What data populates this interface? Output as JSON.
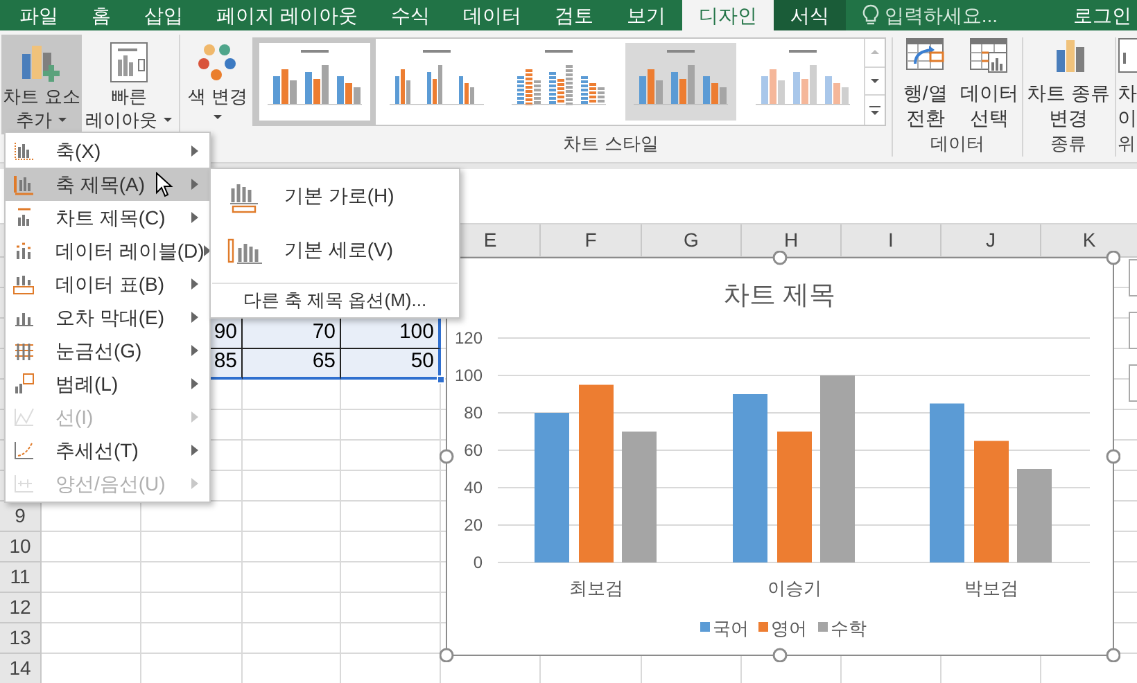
{
  "tabs": [
    {
      "label": "파일",
      "selected": false,
      "contextual": false
    },
    {
      "label": "홈",
      "selected": false,
      "contextual": false
    },
    {
      "label": "삽입",
      "selected": false,
      "contextual": false
    },
    {
      "label": "페이지 레이아웃",
      "selected": false,
      "contextual": false
    },
    {
      "label": "수식",
      "selected": false,
      "contextual": false
    },
    {
      "label": "데이터",
      "selected": false,
      "contextual": false
    },
    {
      "label": "검토",
      "selected": false,
      "contextual": false
    },
    {
      "label": "보기",
      "selected": false,
      "contextual": false
    },
    {
      "label": "디자인",
      "selected": true,
      "contextual": false
    },
    {
      "label": "서식",
      "selected": false,
      "contextual": true
    }
  ],
  "search": {
    "placeholder": "입력하세요..."
  },
  "account": {
    "label": "로그인"
  },
  "ribbon": {
    "left_buttons": [
      {
        "lines": [
          "차트 요소",
          "추가"
        ],
        "pressed": true
      },
      {
        "lines": [
          "빠른",
          "레이아웃"
        ],
        "pressed": false
      },
      {
        "lines": [
          "색 변경"
        ],
        "pressed": false
      }
    ],
    "chart_styles": [
      {
        "kind": "plain",
        "selected": true
      },
      {
        "kind": "labeled",
        "selected": false
      },
      {
        "kind": "striped",
        "selected": false
      },
      {
        "kind": "shaded",
        "selected": false
      },
      {
        "kind": "faded",
        "selected": false
      }
    ],
    "chart_styles_label": "차트 스타일",
    "data_buttons": [
      {
        "lines": [
          "행/열",
          "전환"
        ]
      },
      {
        "lines": [
          "데이터",
          "선택"
        ]
      }
    ],
    "data_label": "데이터",
    "type_button": {
      "lines": [
        "차트 종류",
        "변경"
      ]
    },
    "type_label": "종류",
    "cut_button": {
      "lines": [
        "차",
        "이"
      ]
    },
    "cut_label": "위"
  },
  "sheet": {
    "column_headers": [
      "E",
      "F",
      "G",
      "H",
      "I",
      "J",
      "K"
    ],
    "row_headers": [
      "9",
      "10",
      "11",
      "12",
      "13",
      "14"
    ],
    "cells": [
      [
        "90",
        "70",
        "100"
      ],
      [
        "85",
        "65",
        "50"
      ]
    ]
  },
  "chart": {
    "chart_data": {
      "type": "bar",
      "title": "차트 제목",
      "categories": [
        "최보검",
        "이승기",
        "박보검"
      ],
      "series": [
        {
          "name": "국어",
          "color": "#5b9bd5",
          "values": [
            80,
            90,
            85
          ]
        },
        {
          "name": "영어",
          "color": "#ed7d31",
          "values": [
            95,
            70,
            65
          ]
        },
        {
          "name": "수학",
          "color": "#a5a5a5",
          "values": [
            70,
            100,
            50
          ]
        }
      ],
      "ylim": [
        0,
        120
      ],
      "yticks": [
        0,
        20,
        40,
        60,
        80,
        100,
        120
      ],
      "grid": true,
      "legend": true
    }
  },
  "menu": {
    "items": [
      {
        "label": "축(X)",
        "selected": false,
        "disabled": false
      },
      {
        "label": "축 제목(A)",
        "selected": true,
        "disabled": false
      },
      {
        "label": "차트 제목(C)",
        "selected": false,
        "disabled": false
      },
      {
        "label": "데이터 레이블(D)",
        "selected": false,
        "disabled": false
      },
      {
        "label": "데이터 표(B)",
        "selected": false,
        "disabled": false
      },
      {
        "label": "오차 막대(E)",
        "selected": false,
        "disabled": false
      },
      {
        "label": "눈금선(G)",
        "selected": false,
        "disabled": false
      },
      {
        "label": "범례(L)",
        "selected": false,
        "disabled": false
      },
      {
        "label": "선(I)",
        "selected": false,
        "disabled": true
      },
      {
        "label": "추세선(T)",
        "selected": false,
        "disabled": false
      },
      {
        "label": "양선/음선(U)",
        "selected": false,
        "disabled": true
      }
    ]
  },
  "submenu": {
    "items": [
      {
        "label": "기본 가로(H)"
      },
      {
        "label": "기본 세로(V)"
      }
    ],
    "more_options": "다른 축 제목 옵션(M)..."
  }
}
